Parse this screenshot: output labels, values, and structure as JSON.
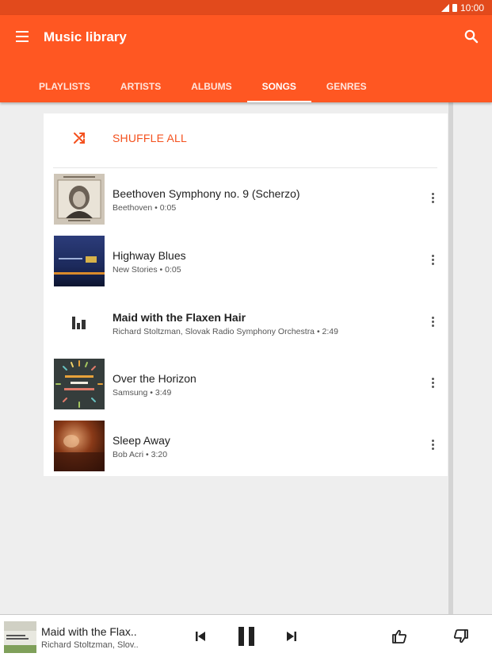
{
  "status": {
    "time": "10:00"
  },
  "appbar": {
    "title": "Music library",
    "menu_icon": "hamburger-menu-icon",
    "search_icon": "search-icon"
  },
  "tabs": [
    {
      "label": "PLAYLISTS",
      "active": false
    },
    {
      "label": "ARTISTS",
      "active": false
    },
    {
      "label": "ALBUMS",
      "active": false
    },
    {
      "label": "SONGS",
      "active": true
    },
    {
      "label": "GENRES",
      "active": false
    }
  ],
  "shuffle": {
    "label": "SHUFFLE ALL",
    "icon": "shuffle-icon",
    "color": "#f4511e"
  },
  "songs": [
    {
      "title": "Beethoven Symphony no. 9 (Scherzo)",
      "subtitle": "Beethoven • 0:05",
      "art": "beethoven-portrait-art"
    },
    {
      "title": "Highway Blues",
      "subtitle": "New Stories • 0:05",
      "art": "new-stories-album-art"
    },
    {
      "title": "Maid with the Flaxen Hair",
      "subtitle": "Richard Stoltzman, Slovak Radio Symphony Orchestra • 2:49",
      "art": "now-playing-equalizer-icon",
      "playing": true
    },
    {
      "title": "Over the Horizon",
      "subtitle": "Samsung • 3:49",
      "art": "over-the-horizon-album-art"
    },
    {
      "title": "Sleep Away",
      "subtitle": "Bob Acri • 3:20",
      "art": "sleep-away-album-art"
    }
  ],
  "player": {
    "title": "Maid with the Flax..",
    "subtitle": "Richard Stoltzman, Slov..",
    "controls": [
      "previous-icon",
      "pause-icon",
      "next-icon",
      "thumbs-up-icon",
      "thumbs-down-icon"
    ]
  },
  "colors": {
    "accent": "#ff5722",
    "status_bar": "#e24a1c"
  }
}
